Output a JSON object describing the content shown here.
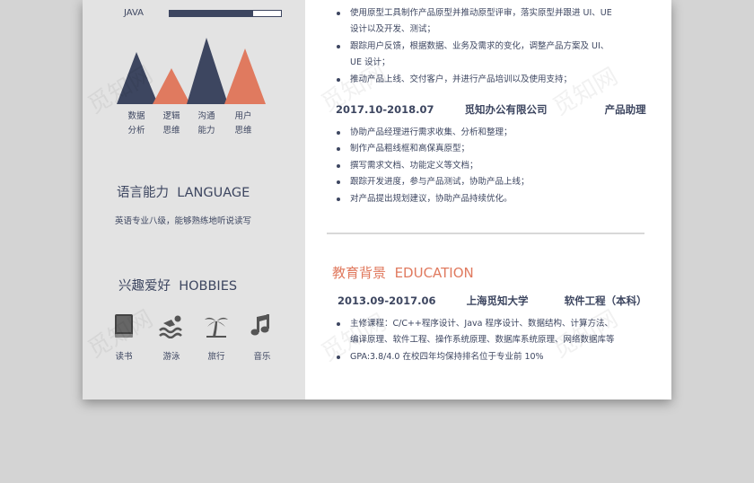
{
  "colors": {
    "navy": "#3d4660",
    "coral": "#e07a5f",
    "sidebar": "#e3e3e3",
    "page": "#d4d4d4"
  },
  "sidebar": {
    "skill": {
      "label": "JAVA",
      "level": 0.75
    },
    "abilities": [
      {
        "label1": "数据",
        "label2": "分析",
        "color": "navy"
      },
      {
        "label1": "逻辑",
        "label2": "思维",
        "color": "coral"
      },
      {
        "label1": "沟通",
        "label2": "能力",
        "color": "navy"
      },
      {
        "label1": "用户",
        "label2": "思维",
        "color": "coral"
      }
    ],
    "language": {
      "title_cn": "语言能力",
      "title_en": "LANGUAGE",
      "text": "英语专业八级，能够熟练地听说读写"
    },
    "hobbies": {
      "title_cn": "兴趣爱好",
      "title_en": "HOBBIES",
      "items": [
        {
          "label": "读书",
          "icon": "book-icon"
        },
        {
          "label": "游泳",
          "icon": "swim-icon"
        },
        {
          "label": "旅行",
          "icon": "palm-tree-icon"
        },
        {
          "label": "音乐",
          "icon": "music-note-icon"
        }
      ]
    }
  },
  "main": {
    "job1_bullets": [
      "使用原型工具制作产品原型并推动原型评审，落实原型并跟进 UI、UE",
      "设计以及开发、测试；",
      "跟踪用户反馈，根据数据、业务及需求的变化，调整产品方案及 UI、",
      "UE 设计；",
      "推动产品上线、交付客户，并进行产品培训以及使用支持；"
    ],
    "job2": {
      "period": "2017.10-2018.07",
      "company": "觅知办公有限公司",
      "position": "产品助理",
      "bullets": [
        "协助产品经理进行需求收集、分析和整理；",
        "制作产品粗线框和高保真原型；",
        "撰写需求文档、功能定义等文档；",
        "跟踪开发进度，参与产品测试，协助产品上线；",
        "对产品提出规划建议，协助产品持续优化。"
      ]
    },
    "education": {
      "title_cn": "教育背景",
      "title_en": "EDUCATION",
      "period": "2013.09-2017.06",
      "school": "上海觅知大学",
      "major": "软件工程（本科）",
      "bullets": [
        "主修课程：C/C++程序设计、Java 程序设计、数据结构、计算方法、",
        "编译原理、软件工程、操作系统原理、数据库系统原理、网络数据库等",
        "GPA:3.8/4.0  在校四年均保持排名位于专业前 10%"
      ]
    }
  },
  "watermark": "觅知网"
}
